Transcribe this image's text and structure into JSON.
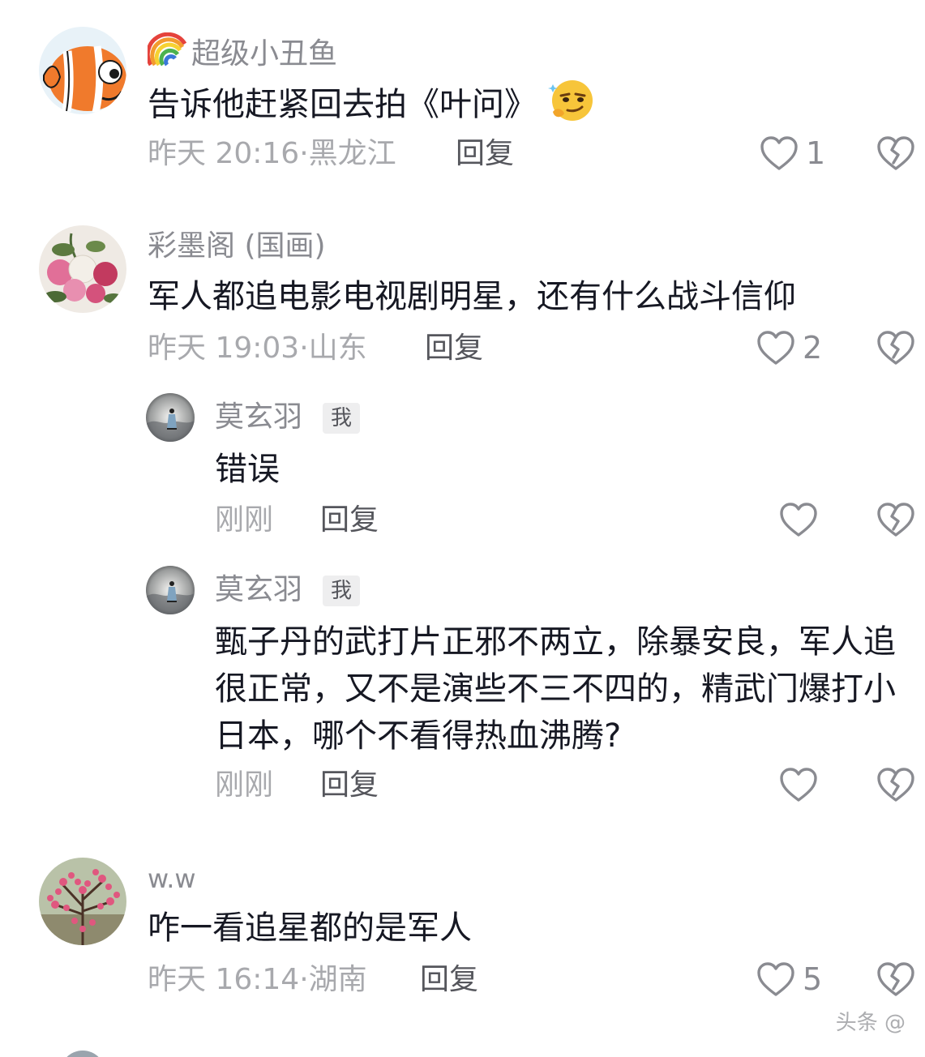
{
  "comments": [
    {
      "username": "超级小丑鱼",
      "text": "告诉他赶紧回去拍《叶问》",
      "time": "昨天 20:16",
      "location": "黑龙江",
      "reply_label": "回复",
      "likes": "1",
      "avatar": "clownfish-avatar",
      "username_icon": "rainbow-icon",
      "trailing_emoji": "thinking-smirk-emoji"
    },
    {
      "username": "彩墨阁 (国画)",
      "text": "军人都追电影电视剧明星，还有什么战斗信仰",
      "time": "昨天 19:03",
      "location": "山东",
      "reply_label": "回复",
      "likes": "2",
      "avatar": "peony-painting-avatar"
    },
    {
      "username": "w.w",
      "text": "咋一看追星都的是军人",
      "time": "昨天 16:14",
      "location": "湖南",
      "reply_label": "回复",
      "likes": "5",
      "avatar": "plum-blossom-avatar"
    }
  ],
  "replies": [
    {
      "username": "莫玄羽",
      "badge": "我",
      "text": "错误",
      "time": "刚刚",
      "reply_label": "回复",
      "avatar": "ink-figure-avatar"
    },
    {
      "username": "莫玄羽",
      "badge": "我",
      "text": "甄子丹的武打片正邪不两立，除暴安良，军人追很正常，又不是演些不三不四的，精武门爆打小日本，哪个不看得热血沸腾?",
      "time": "刚刚",
      "reply_label": "回复",
      "avatar": "ink-figure-avatar"
    }
  ],
  "watermark": "头条 @",
  "colors": {
    "text_primary": "#161823",
    "text_secondary": "#8a8b91",
    "text_meta": "#a8a9ad",
    "icon_gray": "#8a8b91"
  }
}
